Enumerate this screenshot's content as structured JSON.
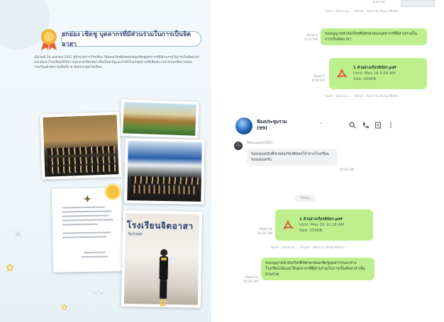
{
  "poster": {
    "banner_title": "ยกย่อง เชิดชู บุคลากรที่มีส่วนร่วมในการเป็นจิตอาสา",
    "body_text": "เมื่อวันที่ 29 เมษายน 2567 ผู้อำนวยการโรงเรียน ได้มอบเกียรติบัตรยกย่องเชิดชูบุคลากรที่มีส่วนร่วมในการเป็นจิตอาสา และพัฒนาโรงเรียนให้มีความสะอาดเรียบร้อย เพื่อเป็นขวัญและกำลังใจแก่บุคลากรที่เสียสละเวลาช่วยเหลืองานของโรงเรียนด้วยความเต็มใจ ณ ห้องประชุมโรงเรียน",
    "sign_text": "โรงเรียนจิตอาสา",
    "sign_sub": "School"
  },
  "chat": {
    "top_time": "9:54 AM",
    "top_actions": "Save · Save as... · Share · Send to Keep Memo",
    "messages": [
      {
        "id": "m1",
        "read": "Read 1",
        "time": "9:53 AM",
        "text": "ขออนุญาตนำส่งเกียรติบัตรยกย่องบุคลากรที่มีส่วนร่วมในการเป็นจิตอาสา"
      },
      {
        "id": "m2",
        "read": "Read 1",
        "time": "9:54 AM",
        "file_name": "1 ตัวอย่างเกียรติบัตร.pdf",
        "file_until": "Until: May 16 9:54 AM",
        "file_size": "Size: 556KB"
      },
      {
        "id": "m4",
        "read": "Read 14",
        "time": "10:16 AM",
        "file_name": "1 ตัวอย่างเกียรติบัตร.pdf",
        "file_until": "Until: May 16 10:16 AM",
        "file_size": "Size: 556KB"
      },
      {
        "id": "m5",
        "read": "Read 14",
        "time": "10:16 AM",
        "text": "ขออนุญาตนำส่งเกียรติบัตรยกย่องเชิดชูบุคลากรและทางโรงเรียนได้มอบให้บุคลากรที่มีส่วนร่วมในการเป็นจิตอาสาเพื่อส่วนรวม"
      }
    ],
    "file_actions": "Save · Save as... · Share · Send to Keep Memo",
    "header": {
      "group_name": "ห้องประชุมรวม",
      "member_count": "(99)",
      "chevron": "⌄"
    },
    "incoming": {
      "sender": "Monoyuom2567",
      "text": "ขอบคุณครับที่ช่วยส่งเกียรติบัตรให้ ทางโรงเรียน ขอบคุณครับ",
      "time": "10:22 AM"
    },
    "day_divider": "Today"
  },
  "colors": {
    "bubble_green": "#bdf08d",
    "bubble_gray": "#f1f2f4",
    "pdf_red": "#e0443a",
    "medal_gold": "#f2b533"
  },
  "icons": {
    "search": "search-icon",
    "call": "phone-icon",
    "notes": "notes-icon",
    "menu": "more-vertical-icon",
    "pdf": "pdf-file-icon",
    "medal": "medal-icon"
  }
}
